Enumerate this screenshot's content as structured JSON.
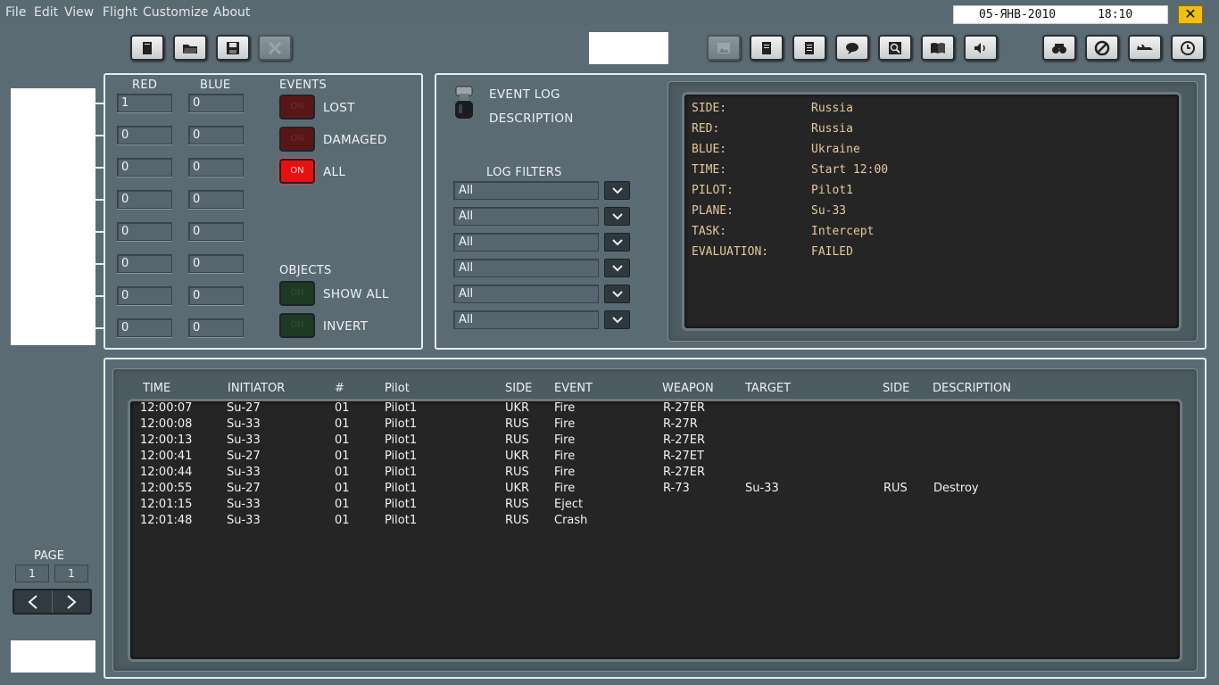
{
  "menu": [
    "File",
    "Edit",
    "View",
    "Flight",
    "Customize",
    "About"
  ],
  "datetime": {
    "date": "05-ЯНВ-2010",
    "time": "18:10"
  },
  "toolbar": {
    "left": [
      "new-icon",
      "open-folder-icon",
      "save-icon",
      "delete-icon"
    ],
    "right": [
      "image-icon",
      "document-icon",
      "list-icon",
      "chat-icon",
      "zoom-icon",
      "book-icon",
      "sound-icon"
    ],
    "far_right": [
      "binoculars-icon",
      "no-entry-icon",
      "plane-icon",
      "clock-icon"
    ]
  },
  "stats": {
    "red_header": "RED",
    "blue_header": "BLUE",
    "rows": [
      {
        "red": "1",
        "blue": "0"
      },
      {
        "red": "0",
        "blue": "0"
      },
      {
        "red": "0",
        "blue": "0"
      },
      {
        "red": "0",
        "blue": "0"
      },
      {
        "red": "0",
        "blue": "0"
      },
      {
        "red": "0",
        "blue": "0"
      },
      {
        "red": "0",
        "blue": "0"
      },
      {
        "red": "0",
        "blue": "0"
      }
    ]
  },
  "events": {
    "header": "EVENTS",
    "items": [
      {
        "label": "LOST",
        "state": "off",
        "color": "red",
        "button_text": "ON"
      },
      {
        "label": "DAMAGED",
        "state": "off",
        "color": "red",
        "button_text": "ON"
      },
      {
        "label": "ALL",
        "state": "on",
        "color": "red",
        "button_text": "ON"
      }
    ]
  },
  "objects": {
    "header": "OBJECTS",
    "items": [
      {
        "label": "SHOW ALL",
        "state": "off",
        "color": "green",
        "button_text": "ON"
      },
      {
        "label": "INVERT",
        "state": "off",
        "color": "green",
        "button_text": "ON"
      }
    ]
  },
  "mode_switch": {
    "top_label": "EVENT LOG",
    "bottom_label": "DESCRIPTION"
  },
  "log_filters": {
    "header": "LOG FILTERS",
    "values": [
      "All",
      "All",
      "All",
      "All",
      "All",
      "All"
    ]
  },
  "info": [
    {
      "key": "SIDE:",
      "value": "Russia"
    },
    {
      "key": "RED:",
      "value": "Russia"
    },
    {
      "key": "BLUE:",
      "value": "Ukraine"
    },
    {
      "key": "TIME:",
      "value": "Start 12:00"
    },
    {
      "key": "PILOT:",
      "value": "Pilot1"
    },
    {
      "key": "PLANE:",
      "value": "Su-33"
    },
    {
      "key": "TASK:",
      "value": "Intercept"
    },
    {
      "key": "EVALUATION:",
      "value": "FAILED"
    }
  ],
  "log_table": {
    "columns": [
      "TIME",
      "INITIATOR",
      "#",
      "Pilot",
      "SIDE",
      "EVENT",
      "WEAPON",
      "TARGET",
      "SIDE",
      "DESCRIPTION"
    ],
    "rows": [
      [
        "12:00:07",
        "Su-27",
        "01",
        "Pilot1",
        "UKR",
        "Fire",
        "R-27ER",
        "",
        "",
        ""
      ],
      [
        "12:00:08",
        "Su-33",
        "01",
        "Pilot1",
        "RUS",
        "Fire",
        "R-27R",
        "",
        "",
        ""
      ],
      [
        "12:00:13",
        "Su-33",
        "01",
        "Pilot1",
        "RUS",
        "Fire",
        "R-27ER",
        "",
        "",
        ""
      ],
      [
        "12:00:41",
        "Su-27",
        "01",
        "Pilot1",
        "UKR",
        "Fire",
        "R-27ET",
        "",
        "",
        ""
      ],
      [
        "12:00:44",
        "Su-33",
        "01",
        "Pilot1",
        "RUS",
        "Fire",
        "R-27ER",
        "",
        "",
        ""
      ],
      [
        "12:00:55",
        "Su-27",
        "01",
        "Pilot1",
        "UKR",
        "Fire",
        "R-73",
        "Su-33",
        "RUS",
        "Destroy"
      ],
      [
        "12:01:15",
        "Su-33",
        "01",
        "Pilot1",
        "RUS",
        "Eject",
        "",
        "",
        "",
        ""
      ],
      [
        "12:01:48",
        "Su-33",
        "01",
        "Pilot1",
        "RUS",
        "Crash",
        "",
        "",
        "",
        ""
      ]
    ]
  },
  "pagination": {
    "label": "PAGE",
    "current": "1",
    "total": "1"
  }
}
